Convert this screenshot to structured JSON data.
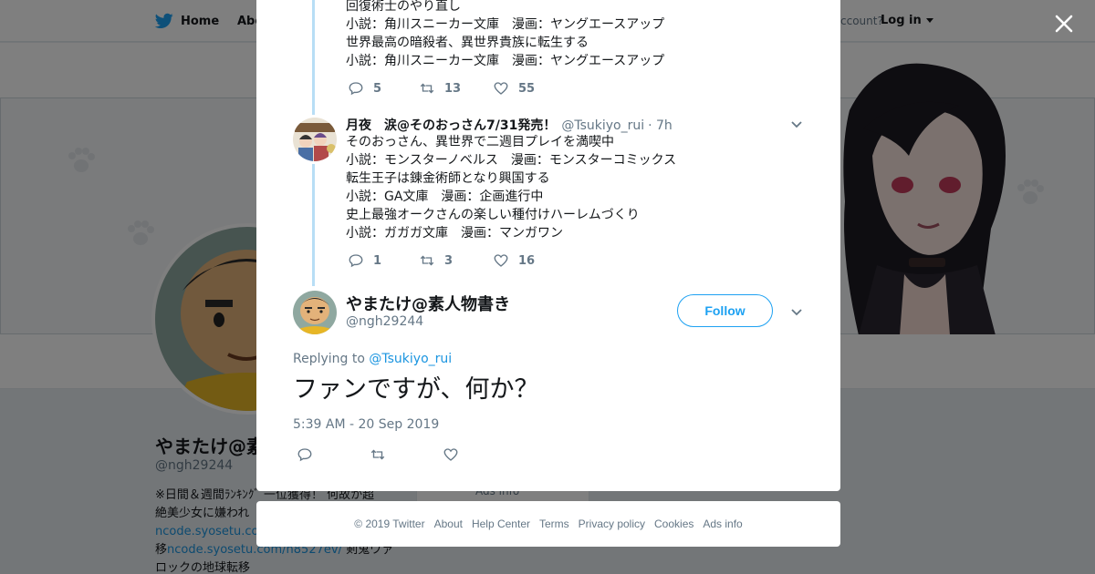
{
  "background": {
    "nav": {
      "home_label": "Home",
      "about_label": "Abo",
      "account_prompt": "ccount?",
      "login_label": "Log in"
    },
    "profile": {
      "name": "やまたけ@素",
      "handle": "@ngh29244",
      "bio_lines": [
        "※日間＆週間ﾗﾝｷﾝｸﾞ 一位獲得！ 何故か超",
        "絶美少女に嫌われ"
      ],
      "bio_link1": "ncode.syosetu.co",
      "bio_line4_prefix": "移",
      "bio_link2": "ncode.syosetu.com/n8527ev/",
      "bio_line4_suffix": " 剣鬼ウァ",
      "bio_line5": "ロックの地球転移",
      "card_label": "Ads info"
    }
  },
  "modal": {
    "tweet1": {
      "lines": [
        "回復術士のやり直し",
        "小説：角川スニーカー文庫　漫画：ヤングエースアップ",
        "世界最高の暗殺者、異世界貴族に転生する",
        "小説：角川スニーカー文庫　漫画：ヤングエースアップ"
      ],
      "replies": "5",
      "retweets": "13",
      "likes": "55"
    },
    "tweet2": {
      "author_name": "月夜　涙@そのおっさん7/31発売！",
      "author_handle": "@Tsukiyo_rui",
      "time": "· 7h",
      "lines": [
        "そのおっさん、異世界で二週目プレイを満喫中",
        "小説：モンスターノベルス　漫画：モンスターコミックス",
        "転生王子は錬金術師となり興国する",
        "小説：GA文庫　漫画：企画進行中",
        "史上最強オークさんの楽しい種付けハーレムづくり",
        "小説：ガガガ文庫　漫画：マンガワン"
      ],
      "replies": "1",
      "retweets": "3",
      "likes": "16"
    },
    "main_tweet": {
      "author_name": "やまたけ@素人物書き",
      "author_handle": "@ngh29244",
      "follow_label": "Follow",
      "replying_prefix": "Replying to ",
      "replying_to": "@Tsukiyo_rui",
      "text": "ファンですが、何か？",
      "timestamp": "5:39 AM - 20 Sep 2019"
    }
  },
  "footer": {
    "links": [
      "© 2019 Twitter",
      "About",
      "Help Center",
      "Terms",
      "Privacy policy",
      "Cookies",
      "Ads info"
    ]
  },
  "colors": {
    "accent": "#1da1f2",
    "link": "#1b95e0",
    "thread_line": "#b8def5",
    "muted": "#657786"
  },
  "icons": [
    "twitter-bird-icon",
    "close-icon",
    "reply-icon",
    "retweet-icon",
    "like-icon",
    "chevron-down-icon"
  ]
}
